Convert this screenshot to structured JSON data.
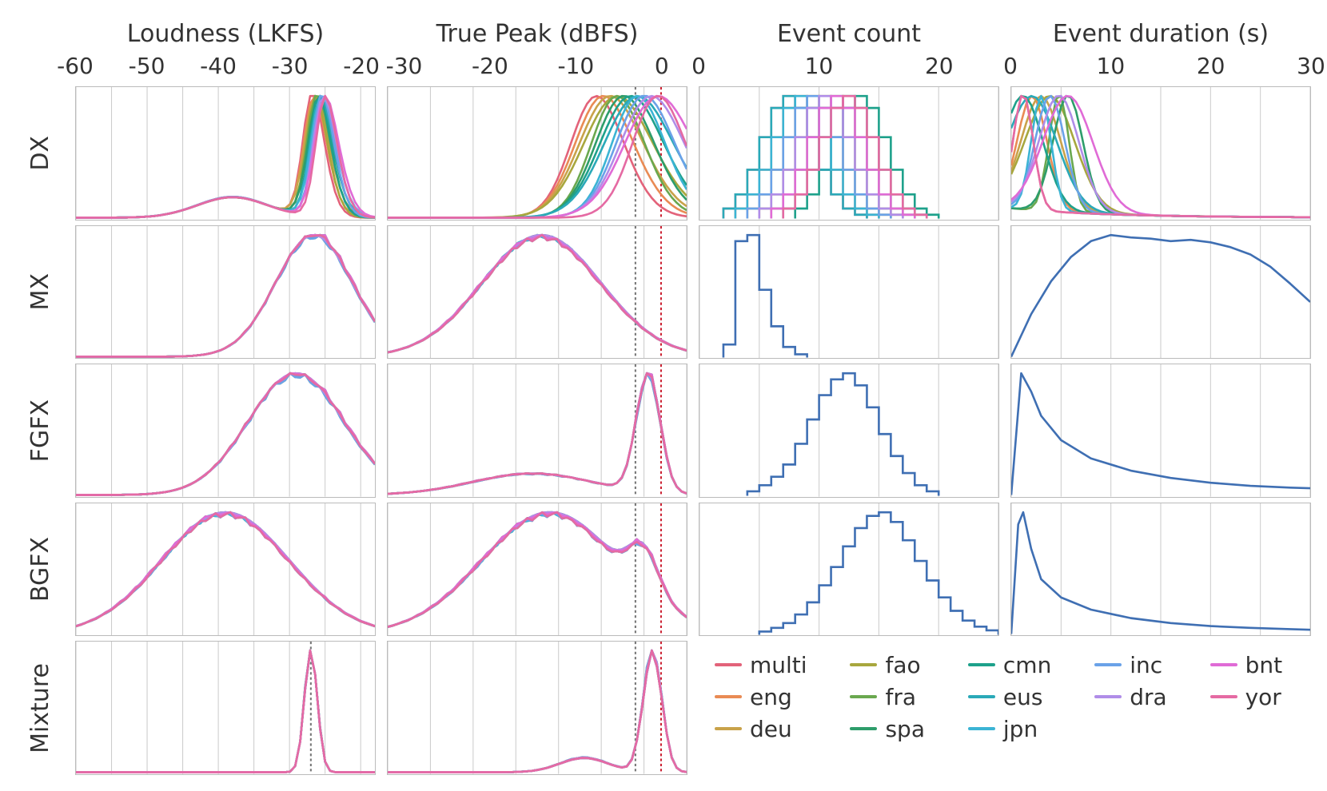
{
  "columns": [
    {
      "key": "loudness",
      "title": "Loudness (LKFS)",
      "ticks": [
        -60,
        -50,
        -40,
        -30,
        -20
      ],
      "range": [
        -60,
        -18
      ]
    },
    {
      "key": "truepeak",
      "title": "True Peak (dBFS)",
      "ticks": [
        -30,
        -20,
        -10,
        0
      ],
      "range": [
        -32,
        3
      ]
    },
    {
      "key": "evcount",
      "title": "Event count",
      "ticks": [
        0,
        10,
        20
      ],
      "range": [
        0,
        25
      ]
    },
    {
      "key": "evdur",
      "title": "Event duration (s)",
      "ticks": [
        0,
        10,
        20,
        30
      ],
      "range": [
        0,
        30
      ]
    }
  ],
  "rows": [
    "DX",
    "MX",
    "FGFX",
    "BGFX",
    "Mixture"
  ],
  "legend": [
    {
      "key": "multi",
      "label": "multi",
      "color": "#e3637a"
    },
    {
      "key": "eng",
      "label": "eng",
      "color": "#e98b54"
    },
    {
      "key": "deu",
      "label": "deu",
      "color": "#c9a24a"
    },
    {
      "key": "fao",
      "label": "fao",
      "color": "#a8a73e"
    },
    {
      "key": "fra",
      "label": "fra",
      "color": "#6aa84f"
    },
    {
      "key": "spa",
      "label": "spa",
      "color": "#2e9d6b"
    },
    {
      "key": "cmn",
      "label": "cmn",
      "color": "#1ea18b"
    },
    {
      "key": "eus",
      "label": "eus",
      "color": "#2aa9b8"
    },
    {
      "key": "jpn",
      "label": "jpn",
      "color": "#3bb4d4"
    },
    {
      "key": "inc",
      "label": "inc",
      "color": "#6aa2e8"
    },
    {
      "key": "dra",
      "label": "dra",
      "color": "#b08de8"
    },
    {
      "key": "bnt",
      "label": "bnt",
      "color": "#e06bd6"
    },
    {
      "key": "yor",
      "label": "yor",
      "color": "#e56aa3"
    }
  ],
  "singleColor": "#3f6fb3",
  "vlines": {
    "truepeak": [
      {
        "x": -3,
        "color": "#777"
      },
      {
        "x": 0,
        "color": "#c23"
      }
    ],
    "loudness_mixture": [
      {
        "x": -27,
        "color": "#777"
      }
    ]
  },
  "chart_data": {
    "description": "Small-multiple grid: 5 rows (DX, MX, FGFX, BGFX, Mixture) by 4 columns of density/histogram panels. Multi-series per-language curves in row DX; near-identical overlaid curves for MX/FGFX/BGFX/Mixture; single-series histograms/densities in cols 3-4 for rows 2-4; legend fills the Mixture row for cols 3-4.",
    "panels": [
      {
        "row": "DX",
        "col": "loudness",
        "type": "kde-multi",
        "peak_x_approx": -27,
        "xrange": [
          -60,
          -18
        ],
        "note": "All language curves tightly clustered, sharp peak around -27 LKFS, gentle left tail to ~-45."
      },
      {
        "row": "DX",
        "col": "truepeak",
        "type": "kde-multi",
        "xrange": [
          -32,
          3
        ],
        "note": "Peaks spread between roughly -8 and -1 dBFS per language; curves broadly similar shape, right-skewed.",
        "vlines": [
          {
            "x": -3
          },
          {
            "x": 0
          }
        ]
      },
      {
        "row": "DX",
        "col": "evcount",
        "type": "hist-step-multi",
        "xrange": [
          0,
          25
        ],
        "note": "Per-language step histograms. Modes vary roughly 6-14 events; most mass in 5-18."
      },
      {
        "row": "DX",
        "col": "evdur",
        "type": "kde-multi",
        "xrange": [
          0,
          30
        ],
        "note": "Right-skewed densities; peaks mostly between ~1s and ~6s depending on language, long tails to 30s."
      },
      {
        "row": "MX",
        "col": "loudness",
        "type": "kde-overlaid",
        "peak_x_approx": -29,
        "xrange": [
          -60,
          -18
        ],
        "note": "Broad hump, peak around -29, left tail extending toward -55."
      },
      {
        "row": "MX",
        "col": "truepeak",
        "type": "kde-overlaid",
        "xrange": [
          -32,
          3
        ],
        "note": "Peak around -14 dBFS, broad bell, tails to -30 and 0.",
        "vlines": [
          {
            "x": -3
          },
          {
            "x": 0
          }
        ]
      },
      {
        "row": "MX",
        "col": "evcount",
        "type": "hist-step",
        "bins": [
          2,
          3,
          4,
          5,
          6,
          7,
          8
        ],
        "counts_norm": [
          0.1,
          0.95,
          1.0,
          0.55,
          0.25,
          0.08,
          0.02
        ],
        "xrange": [
          0,
          25
        ]
      },
      {
        "row": "MX",
        "col": "evdur",
        "type": "kde",
        "x": [
          0,
          2,
          4,
          6,
          8,
          10,
          12,
          14,
          16,
          18,
          20,
          22,
          24,
          26,
          28,
          30
        ],
        "y": [
          0.0,
          0.35,
          0.62,
          0.82,
          0.95,
          1.0,
          0.98,
          0.97,
          0.95,
          0.96,
          0.94,
          0.9,
          0.84,
          0.74,
          0.6,
          0.45
        ],
        "xrange": [
          0,
          30
        ]
      },
      {
        "row": "FGFX",
        "col": "loudness",
        "type": "kde-overlaid",
        "peak_x_approx": -31,
        "xrange": [
          -60,
          -18
        ],
        "note": "Broad peak roughly -33 to -29 with slight plateau; long left tail."
      },
      {
        "row": "FGFX",
        "col": "truepeak",
        "type": "kde-overlaid",
        "xrange": [
          -32,
          3
        ],
        "note": "Sharp spike near -1.5 dBFS on top of a low broad shoulder from -30 to -5.",
        "vlines": [
          {
            "x": -3
          },
          {
            "x": 0
          }
        ]
      },
      {
        "row": "FGFX",
        "col": "evcount",
        "type": "hist-step",
        "bins": [
          4,
          5,
          6,
          7,
          8,
          9,
          10,
          11,
          12,
          13,
          14,
          15,
          16,
          17,
          18,
          19
        ],
        "counts_norm": [
          0.03,
          0.08,
          0.15,
          0.25,
          0.42,
          0.62,
          0.82,
          0.95,
          1.0,
          0.9,
          0.72,
          0.5,
          0.32,
          0.18,
          0.08,
          0.03
        ],
        "xrange": [
          0,
          25
        ]
      },
      {
        "row": "FGFX",
        "col": "evdur",
        "type": "kde",
        "x": [
          0,
          1,
          2,
          3,
          5,
          8,
          12,
          16,
          20,
          24,
          28,
          30
        ],
        "y": [
          0.0,
          1.0,
          0.85,
          0.65,
          0.45,
          0.3,
          0.2,
          0.14,
          0.1,
          0.075,
          0.06,
          0.055
        ],
        "xrange": [
          0,
          30
        ]
      },
      {
        "row": "BGFX",
        "col": "loudness",
        "type": "kde-overlaid",
        "xrange": [
          -60,
          -18
        ],
        "note": "Very broad bimodal-ish hump spanning roughly -48 to -30 with near-flat top around -42 to -36."
      },
      {
        "row": "BGFX",
        "col": "truepeak",
        "type": "kde-overlaid",
        "xrange": [
          -32,
          3
        ],
        "note": "Broad hump peaking around -13 dBFS, dip then small secondary rise near -2.",
        "vlines": [
          {
            "x": -3
          },
          {
            "x": 0
          }
        ]
      },
      {
        "row": "BGFX",
        "col": "evcount",
        "type": "hist-step",
        "bins": [
          5,
          6,
          7,
          8,
          9,
          10,
          11,
          12,
          13,
          14,
          15,
          16,
          17,
          18,
          19,
          20,
          21,
          22,
          23,
          24
        ],
        "counts_norm": [
          0.02,
          0.05,
          0.09,
          0.16,
          0.26,
          0.4,
          0.55,
          0.72,
          0.87,
          0.97,
          1.0,
          0.92,
          0.77,
          0.6,
          0.44,
          0.3,
          0.19,
          0.11,
          0.06,
          0.03
        ],
        "xrange": [
          0,
          25
        ]
      },
      {
        "row": "BGFX",
        "col": "evdur",
        "type": "kde",
        "x": [
          0,
          0.7,
          1.2,
          2,
          3,
          5,
          8,
          12,
          16,
          20,
          24,
          28,
          30
        ],
        "y": [
          0.0,
          0.9,
          1.0,
          0.7,
          0.45,
          0.3,
          0.2,
          0.13,
          0.09,
          0.065,
          0.05,
          0.04,
          0.035
        ],
        "xrange": [
          0,
          30
        ]
      },
      {
        "row": "Mixture",
        "col": "loudness",
        "type": "kde-overlaid",
        "peak_x_approx": -27,
        "xrange": [
          -60,
          -18
        ],
        "note": "Very narrow spike centered at -27 LKFS.",
        "vlines": [
          {
            "x": -27,
            "color": "#777"
          }
        ]
      },
      {
        "row": "Mixture",
        "col": "truepeak",
        "type": "kde-overlaid",
        "xrange": [
          -32,
          3
        ],
        "note": "Sharp narrow spike near -1 dBFS with a small low shoulder from ~-12 to -5.",
        "vlines": [
          {
            "x": -3
          },
          {
            "x": 0
          }
        ]
      }
    ]
  }
}
